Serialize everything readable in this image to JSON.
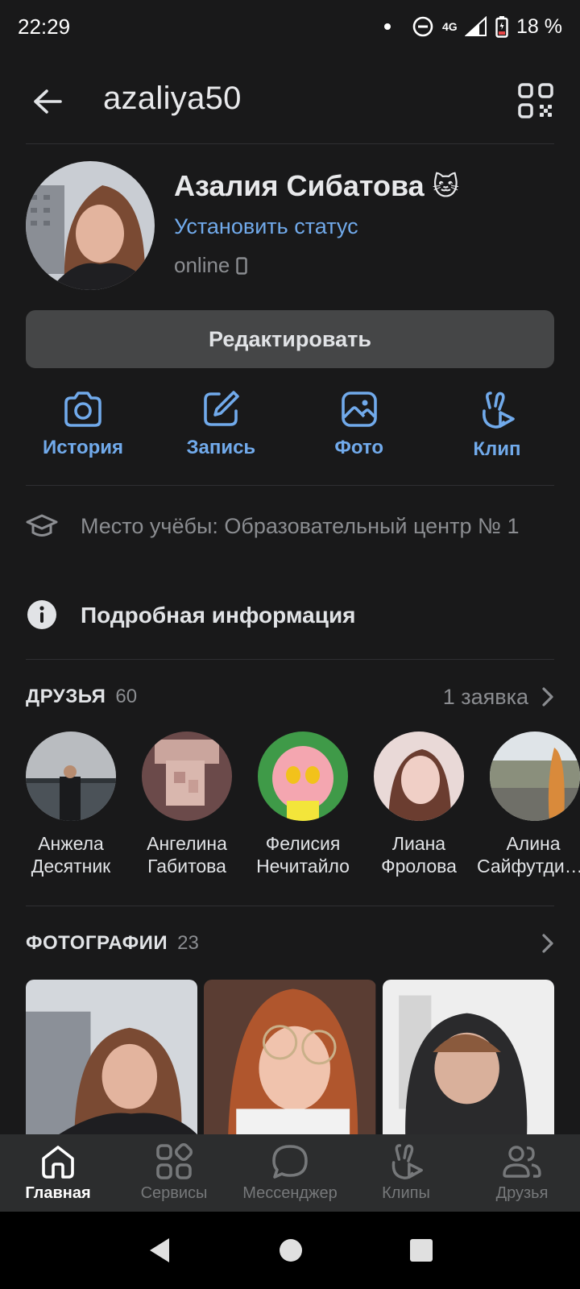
{
  "status_bar": {
    "time": "22:29",
    "network": "4G",
    "battery": "18 %"
  },
  "header": {
    "username": "azaliya50"
  },
  "profile": {
    "name": "Азалия Сибатова",
    "name_emoji": "🐱",
    "status_link": "Установить статус",
    "online": "online",
    "edit_button": "Редактировать"
  },
  "actions": [
    {
      "label": "История",
      "icon": "camera-icon"
    },
    {
      "label": "Запись",
      "icon": "edit-icon"
    },
    {
      "label": "Фото",
      "icon": "image-icon"
    },
    {
      "label": "Клип",
      "icon": "clip-icon"
    }
  ],
  "info": {
    "education": "Место учёбы: Образовательный центр № 1",
    "details": "Подробная информация"
  },
  "friends_section": {
    "title": "ДРУЗЬЯ",
    "count": "60",
    "requests": "1 заявка",
    "items": [
      {
        "name": "Анжела Десятник"
      },
      {
        "name": "Ангелина Габитова"
      },
      {
        "name": "Фелисия Нечитайло"
      },
      {
        "name": "Лиана Фролова"
      },
      {
        "name": "Алина Сайфутдинова"
      }
    ]
  },
  "photos_section": {
    "title": "ФОТОГРАФИИ",
    "count": "23"
  },
  "tabbar": [
    {
      "label": "Главная",
      "icon": "home-icon",
      "active": true
    },
    {
      "label": "Сервисы",
      "icon": "services-icon"
    },
    {
      "label": "Мессенджер",
      "icon": "messenger-icon"
    },
    {
      "label": "Клипы",
      "icon": "clips-icon"
    },
    {
      "label": "Друзья",
      "icon": "friends-icon"
    }
  ],
  "colors": {
    "accent": "#71aaeb",
    "background": "#19191a",
    "tabbar": "#2c2d2e",
    "button": "#454647"
  }
}
